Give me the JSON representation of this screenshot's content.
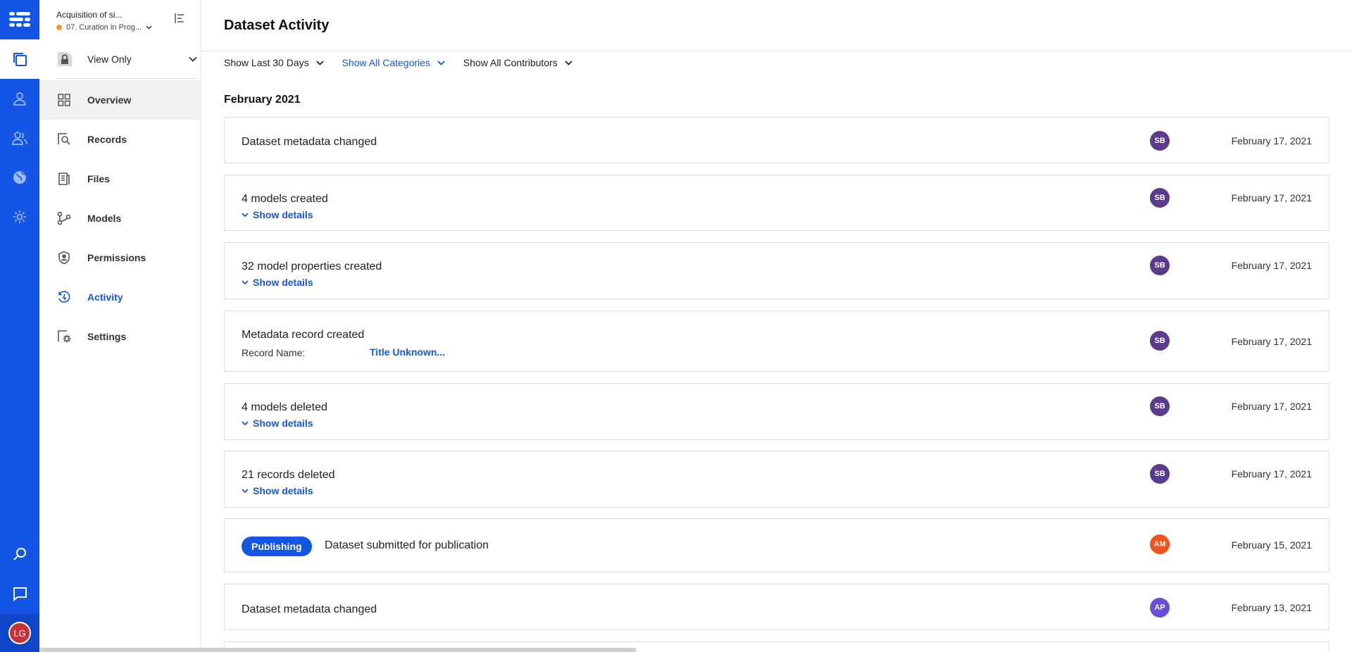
{
  "rail": {
    "logo_icon": "app-grid-logo-icon",
    "items": [
      "datasets-icon",
      "person-icon",
      "people-icon",
      "globe-icon",
      "gear-icon"
    ],
    "bottom": [
      "search-icon",
      "chat-icon"
    ],
    "user_initials": "LG"
  },
  "sidebar": {
    "dataset_title": "Acquisition of si...",
    "dataset_status": "07. Curation in Prog...",
    "permission": "View Only",
    "nav": [
      {
        "label": "Overview"
      },
      {
        "label": "Records"
      },
      {
        "label": "Files"
      },
      {
        "label": "Models"
      },
      {
        "label": "Permissions"
      },
      {
        "label": "Activity"
      },
      {
        "label": "Settings"
      }
    ]
  },
  "page": {
    "title": "Dataset Activity",
    "filters": {
      "time": "Show Last 30 Days",
      "categories": "Show All Categories",
      "contributors": "Show All Contributors"
    },
    "month": "February 2021",
    "show_details": "Show details",
    "record_name_label": "Record Name:",
    "activities": [
      {
        "title": "Dataset metadata changed",
        "user": "SB",
        "date": "February 17, 2021"
      },
      {
        "title": "4 models created",
        "user": "SB",
        "date": "February 17, 2021"
      },
      {
        "title": "32 model properties created",
        "user": "SB",
        "date": "February 17, 2021"
      },
      {
        "title": "Metadata record created",
        "record_name": "Title Unknown...",
        "user": "SB",
        "date": "February 17, 2021"
      },
      {
        "title": "4 models deleted",
        "user": "SB",
        "date": "February 17, 2021"
      },
      {
        "title": "21 records deleted",
        "user": "SB",
        "date": "February 17, 2021"
      },
      {
        "badge": "Publishing",
        "title": "Dataset submitted for publication",
        "user": "AM",
        "date": "February 15, 2021"
      },
      {
        "title": "Dataset metadata changed",
        "user": "AP",
        "date": "February 13, 2021"
      }
    ]
  },
  "colors": {
    "primary": "#1455e6",
    "avatar_sb": "#5a3b8c",
    "avatar_am": "#f0531c",
    "avatar_ap": "#6a4fd6",
    "status_dot": "#f0a12b"
  }
}
